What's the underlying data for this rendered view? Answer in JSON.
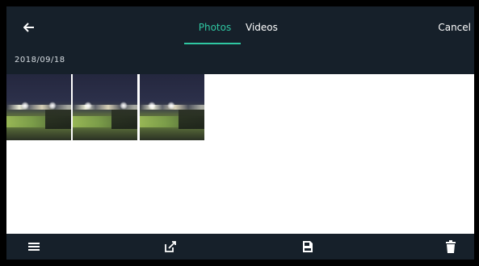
{
  "header": {
    "back_icon": "back-arrow-icon",
    "tabs": [
      {
        "label": "Photos",
        "selected": true
      },
      {
        "label": "Videos",
        "selected": false
      }
    ],
    "cancel_label": "Cancel",
    "date_label": "2018/09/18"
  },
  "gallery": {
    "thumbnails": [
      {
        "kind": "night-field-photo"
      },
      {
        "kind": "night-field-photo"
      },
      {
        "kind": "night-field-photo"
      }
    ]
  },
  "toolbar": {
    "icons": [
      "list-icon",
      "share-icon",
      "save-icon",
      "trash-icon"
    ]
  },
  "colors": {
    "header_bg": "#16202a",
    "accent": "#2fc7a2",
    "text": "#ffffff"
  }
}
